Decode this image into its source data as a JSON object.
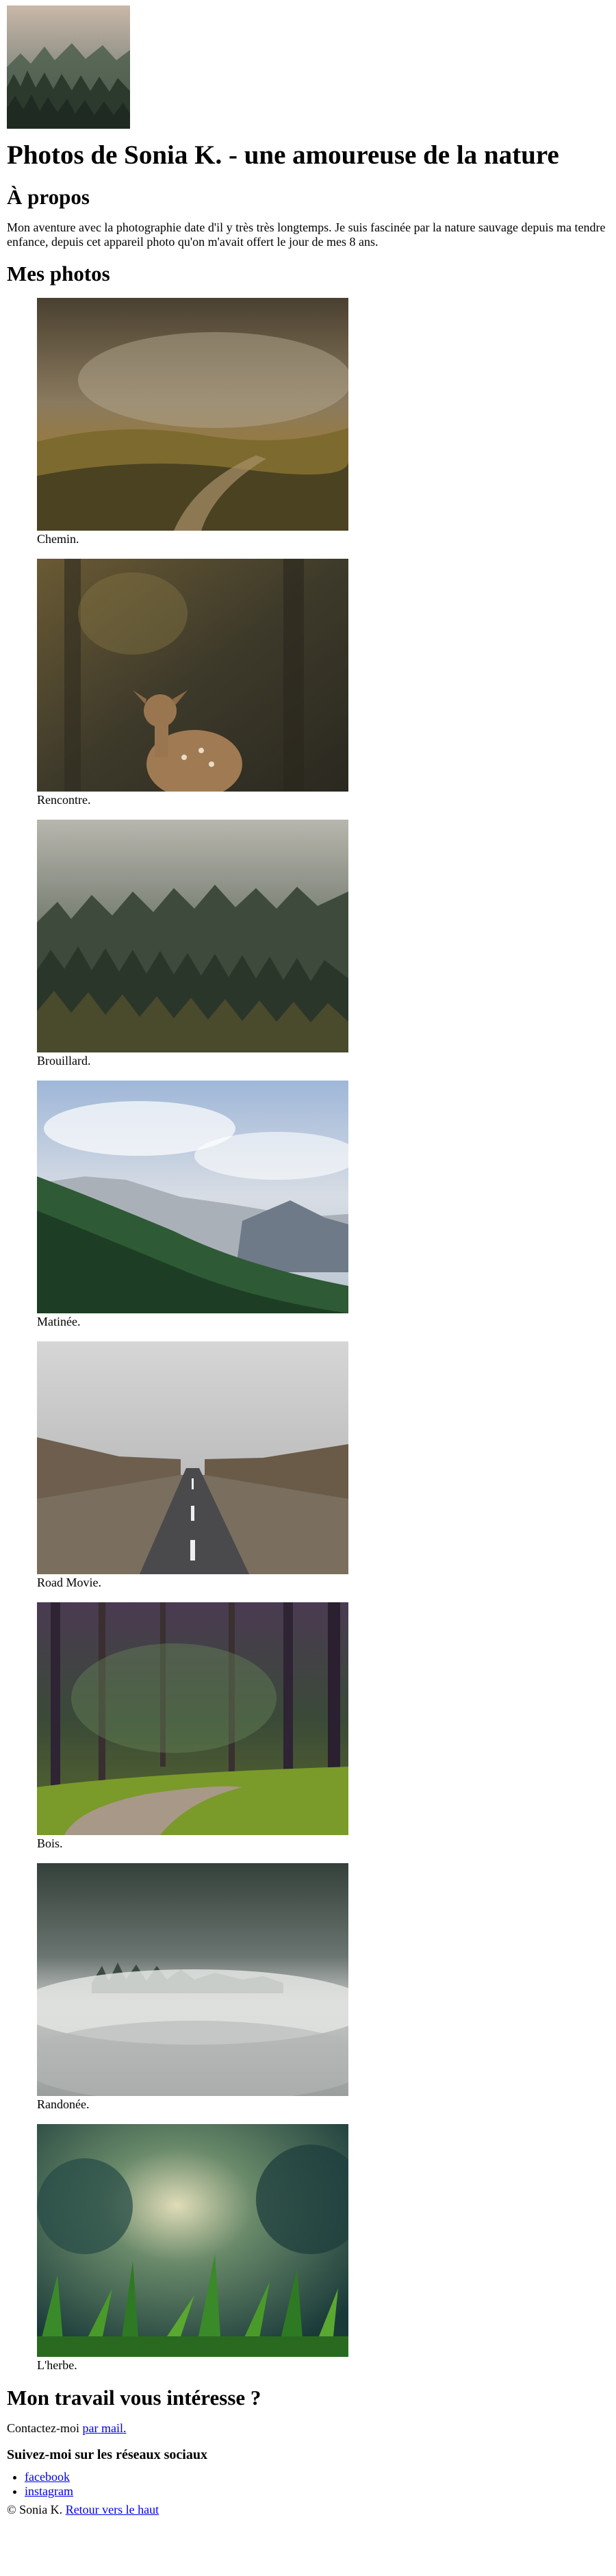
{
  "header": {
    "logo_icon": "forest-photo",
    "title": "Photos de Sonia K. - une amoureuse de la nature"
  },
  "about": {
    "heading": "À propos",
    "text": "Mon aventure avec la photographie date d'il y très très longtemps. Je suis fascinée par la nature sauvage depuis ma tendre enfance, depuis cet appareil photo qu'on m'avait offert le jour de mes 8 ans."
  },
  "gallery": {
    "heading": "Mes photos",
    "items": [
      {
        "caption": "Chemin.",
        "icon": "hill-path-photo"
      },
      {
        "caption": "Rencontre.",
        "icon": "deer-photo"
      },
      {
        "caption": "Brouillard.",
        "icon": "foggy-forest-photo"
      },
      {
        "caption": "Matinée.",
        "icon": "mountain-morning-photo"
      },
      {
        "caption": "Road Movie.",
        "icon": "road-photo"
      },
      {
        "caption": "Bois.",
        "icon": "woods-path-photo"
      },
      {
        "caption": "Randonée.",
        "icon": "mist-photo"
      },
      {
        "caption": "L'herbe.",
        "icon": "grass-photo"
      }
    ]
  },
  "contact": {
    "heading": "Mon travail vous intéresse ?",
    "text": "Contactez-moi ",
    "link": "par mail."
  },
  "social": {
    "heading": "Suivez-moi sur les réseaux sociaux",
    "links": [
      "facebook",
      "instagram"
    ]
  },
  "footer": {
    "copyright": "© Sonia K. ",
    "back_to_top": "Retour vers le haut"
  }
}
